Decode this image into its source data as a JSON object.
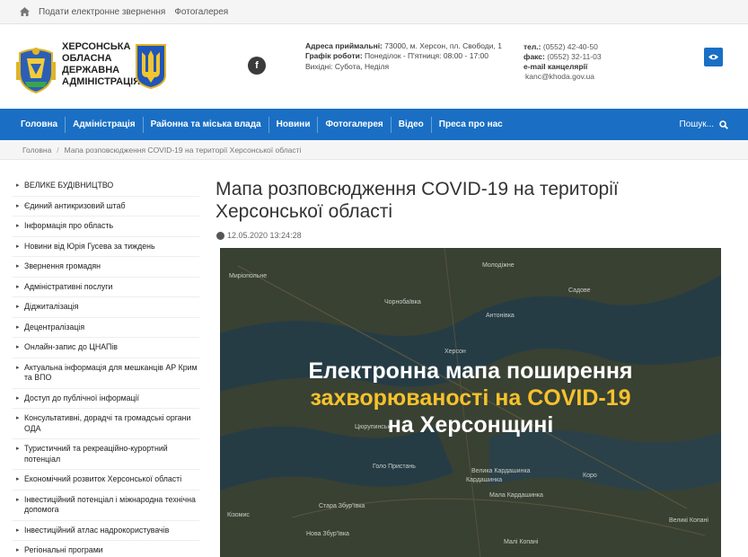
{
  "topbar": {
    "links": [
      "Подати електронне звернення",
      "Фотогалерея"
    ]
  },
  "header": {
    "org_name": "Херсонська обласна державна адміністрація",
    "address_label": "Адреса приймальні:",
    "address_value": "73000, м. Херсон, пл. Свободи, 1",
    "schedule_label": "Графік роботи:",
    "schedule_value": "Понеділок - П'ятниця: 08:00 - 17:00",
    "weekend_value": "Вихідні: Субота, Неділя",
    "tel_label": "тел.:",
    "tel_value": "(0552) 42-40-50",
    "fax_label": "факс:",
    "fax_value": "(0552) 32-11-03",
    "email_label": "e-mail канцелярії",
    "email_value": "kanc@khoda.gov.ua",
    "fb_letter": "f"
  },
  "nav": {
    "items": [
      "Головна",
      "Адміністрація",
      "Районна та міська влада",
      "Новини",
      "Фотогалерея",
      "Відео",
      "Преса про нас"
    ],
    "search_label": "Пошук..."
  },
  "breadcrumb": {
    "home": "Головна",
    "current": "Мапа розповсюдження COVID-19 на території Херсонської області"
  },
  "sidebar": {
    "items": [
      "ВЕЛИКЕ БУДІВНИЦТВО",
      "Єдиний антикризовий штаб",
      "Інформація про область",
      "Новини від Юрія Гусева за тиждень",
      "Звернення громадян",
      "Адміністративні послуги",
      "Діджиталізація",
      "Децентралізація",
      "Онлайн-запис до ЦНАПів",
      "Актуальна інформація для мешканців АР Крим та ВПО",
      "Доступ до публічної інформації",
      "Консультативні, дорадчі та громадські органи ОДА",
      "Туристичний та рекреаційно-курортний потенціал",
      "Економічний розвиток Херсонської області",
      "Інвестиційний потенціал і міжнародна технічна допомога",
      "Інвестиційний атлас надрокористувачів",
      "Регіональні програми"
    ]
  },
  "article": {
    "title": "Мапа розповсюдження COVID-19 на території Херсонської області",
    "date": "12.05.2020 13:24:28",
    "banner_line1": "Електронна мапа поширення",
    "banner_line2": "захворюваності на COVID-19",
    "banner_line3": "на Херсонщині",
    "map_labels": [
      "Миріопольне",
      "Молодіжне",
      "Чорнобаївка",
      "Антонівка",
      "Садове",
      "Херсон",
      "Голо Пристань",
      "Велика Кардашинка",
      "Кардашинка",
      "Коро",
      "Мала Кардашинка",
      "Стара Збур'ївка",
      "Нова Збур'ївка",
      "Малі Копані",
      "Великі Копані",
      "Цюрупинськ",
      "Кізомис"
    ]
  },
  "colors": {
    "nav_blue": "#1a6fc4",
    "banner_yellow": "#f6c22c"
  }
}
